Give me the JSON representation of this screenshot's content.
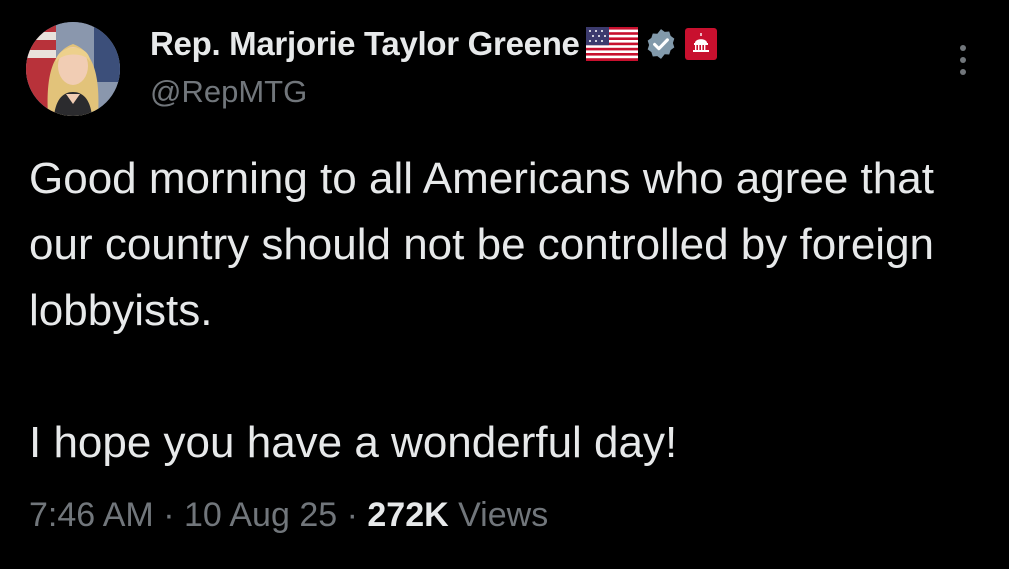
{
  "author": {
    "display_name": "Rep. Marjorie Taylor Greene",
    "handle": "@RepMTG",
    "flag_icon": "us-flag-icon",
    "verified_icon": "verified-badge-icon",
    "affiliation_icon": "capitol-badge-icon"
  },
  "tweet": {
    "paragraph_1": "Good morning to all Americans who agree that our country should not be controlled by foreign lobbyists.",
    "paragraph_2": "I hope you have a wonderful day!"
  },
  "meta": {
    "time": "7:46 AM",
    "separator": "·",
    "date": "10 Aug 25",
    "views_count": "272K",
    "views_label": "Views"
  },
  "colors": {
    "background": "#000000",
    "primary_text": "#e7e9ea",
    "secondary_text": "#71767b",
    "verified_badge": "#829aab",
    "affiliation_badge": "#c8102e"
  }
}
